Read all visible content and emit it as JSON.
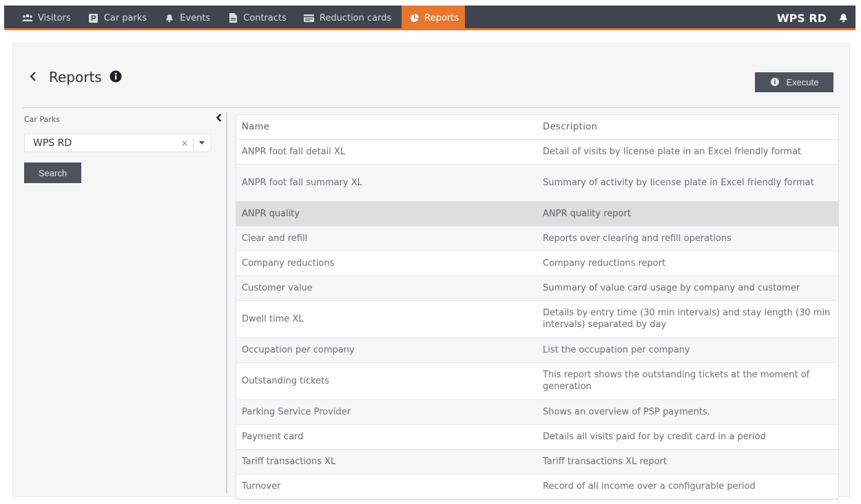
{
  "nav": {
    "items": [
      {
        "label": "Visitors",
        "icon": "users-icon"
      },
      {
        "label": "Car parks",
        "icon": "parking-icon"
      },
      {
        "label": "Events",
        "icon": "bell-icon"
      },
      {
        "label": "Contracts",
        "icon": "document-icon"
      },
      {
        "label": "Reduction cards",
        "icon": "card-icon"
      },
      {
        "label": "Reports",
        "icon": "pie-chart-icon",
        "active": true
      }
    ],
    "brand": "WPS RD",
    "accent_color": "#e8772e",
    "bar_color": "#3f4450"
  },
  "page": {
    "title": "Reports",
    "execute_label": "Execute"
  },
  "filter": {
    "label": "Car Parks",
    "selected_value": "WPS RD",
    "clear_glyph": "×",
    "search_label": "Search"
  },
  "table": {
    "headers": [
      "Name",
      "Description"
    ],
    "selected_row": 2,
    "rows": [
      {
        "name": "ANPR foot fall detail XL",
        "description": "Detail of visits by license plate in an Excel friendly format"
      },
      {
        "name": "ANPR foot fall summary XL",
        "description": "Summary of activity by license plate in Excel friendly format"
      },
      {
        "name": "ANPR quality",
        "description": "ANPR quality report"
      },
      {
        "name": "Clear and refill",
        "description": "Reports over clearing and refill operations"
      },
      {
        "name": "Company reductions",
        "description": "Company reductions report"
      },
      {
        "name": "Customer value",
        "description": "Summary of value card usage by company and customer"
      },
      {
        "name": "Dwell time XL",
        "description": "Details by entry time (30 min intervals) and stay length (30 min intervals) separated by day"
      },
      {
        "name": "Occupation per company",
        "description": "List the occupation per company"
      },
      {
        "name": "Outstanding tickets",
        "description": "This report shows the outstanding tickets at the moment of generation"
      },
      {
        "name": "Parking Service Provider",
        "description": "Shows an overview of PSP payments."
      },
      {
        "name": "Payment card",
        "description": "Details all visits paid for by credit card in a period"
      },
      {
        "name": "Tariff transactions XL",
        "description": "Tariff transactions XL report"
      },
      {
        "name": "Turnover",
        "description": "Record of all income over a configurable period"
      }
    ]
  }
}
